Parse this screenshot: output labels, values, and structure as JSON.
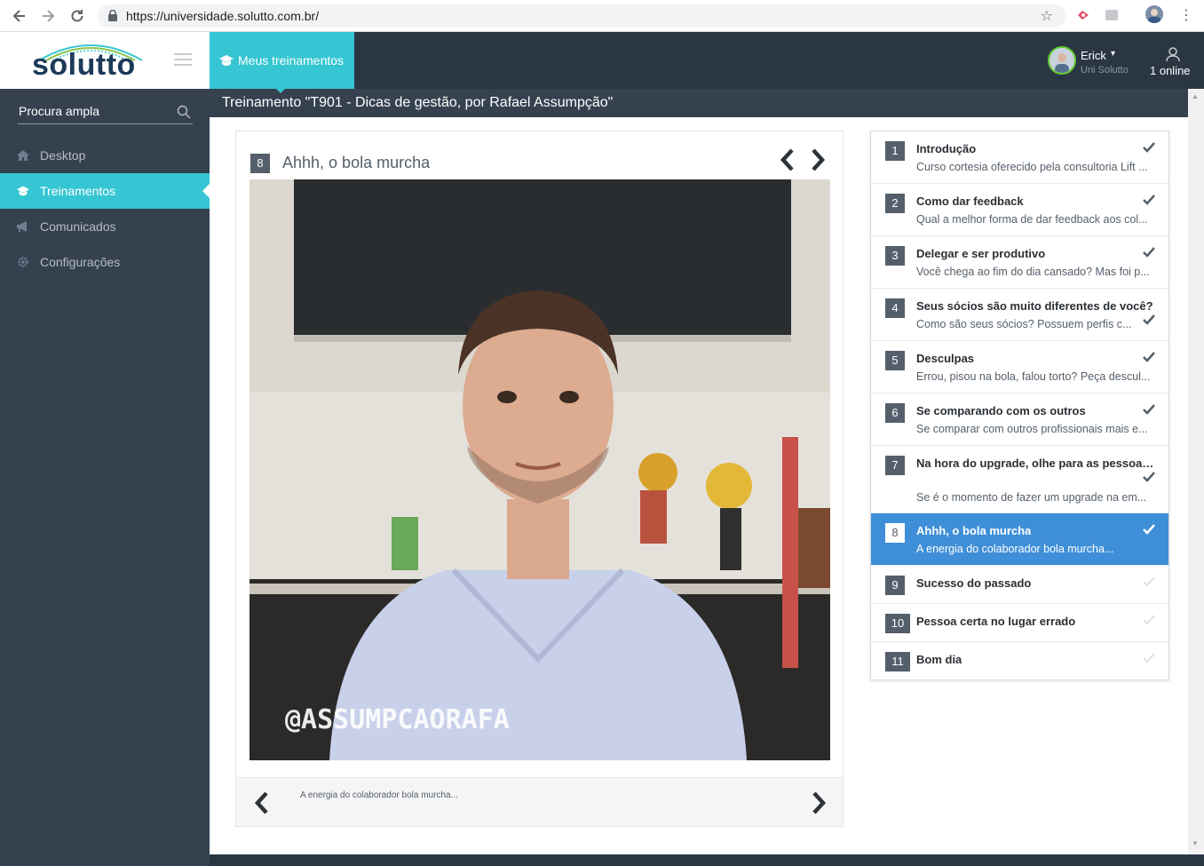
{
  "browser": {
    "url": "https://universidade.solutto.com.br/",
    "back_icon": "back-arrow-icon",
    "forward_icon": "forward-arrow-icon",
    "reload_icon": "reload-icon"
  },
  "brand": {
    "logo_text": "solutto",
    "primary_color": "#36c6d3",
    "dark_color": "#2b3643",
    "active_lesson_color": "#3f8fd8"
  },
  "topbar": {
    "my_trainings_label": "Meus treinamentos",
    "user_name": "Erick",
    "user_org": "Uni Solutto",
    "online_label": "1 online"
  },
  "sidebar": {
    "search_label": "Procura ampla",
    "items": [
      {
        "label": "Desktop",
        "icon": "home-icon"
      },
      {
        "label": "Treinamentos",
        "icon": "graduation-cap-icon"
      },
      {
        "label": "Comunicados",
        "icon": "megaphone-icon"
      },
      {
        "label": "Configurações",
        "icon": "gear-icon"
      }
    ]
  },
  "breadcrumb": "Treinamento \"T901 - Dicas de gestão, por Rafael Assumpção\"",
  "video": {
    "number": "8",
    "title": "Ahhh, o bola murcha",
    "watermark": "@ASSUMPCAORAFA",
    "footer_text": "A energia do colaborador bola murcha..."
  },
  "lessons": [
    {
      "num": "1",
      "title": "Introdução",
      "desc": "Curso cortesia oferecido pela consultoria Lift ...",
      "done": true
    },
    {
      "num": "2",
      "title": "Como dar feedback",
      "desc": "Qual a melhor forma de dar feedback aos col...",
      "done": true
    },
    {
      "num": "3",
      "title": "Delegar e ser produtivo",
      "desc": "Você chega ao fim do dia cansado? Mas foi p...",
      "done": true
    },
    {
      "num": "4",
      "title": "Seus sócios são muito diferentes de você?",
      "desc": "Como são seus sócios? Possuem perfis c...",
      "done": true
    },
    {
      "num": "5",
      "title": "Desculpas",
      "desc": "Errou, pisou na bola, falou torto? Peça descul...",
      "done": true
    },
    {
      "num": "6",
      "title": "Se comparando com os outros",
      "desc": "Se comparar com outros profissionais mais e...",
      "done": true
    },
    {
      "num": "7",
      "title": "Na hora do upgrade, olhe para as pessoas...",
      "desc": "Se é o momento de fazer um upgrade na em...",
      "done": true
    },
    {
      "num": "8",
      "title": "Ahhh, o bola murcha",
      "desc": "A energia do colaborador bola murcha...",
      "done": true,
      "active": true
    },
    {
      "num": "9",
      "title": "Sucesso do passado",
      "desc": "",
      "done": false
    },
    {
      "num": "10",
      "title": "Pessoa certa no lugar errado",
      "desc": "",
      "done": false
    },
    {
      "num": "11",
      "title": "Bom dia",
      "desc": "",
      "done": false
    }
  ]
}
